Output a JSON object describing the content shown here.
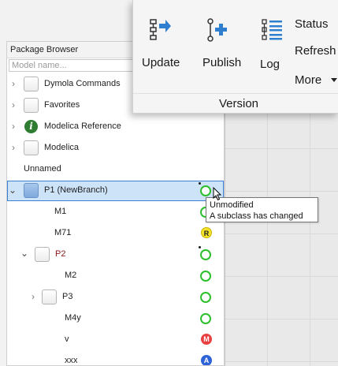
{
  "ribbon": {
    "update_label": "Update",
    "publish_label": "Publish",
    "log_label": "Log",
    "status_label": "Status",
    "refresh_label": "Refresh",
    "more_label": "More",
    "group_label": "Version"
  },
  "browser": {
    "title": "Package Browser",
    "search_placeholder": "Model name...",
    "items": [
      {
        "label": "Dymola Commands"
      },
      {
        "label": "Favorites"
      },
      {
        "label": "Modelica Reference"
      },
      {
        "label": "Modelica"
      },
      {
        "label": "Unnamed"
      },
      {
        "label": "P1 (NewBranch)"
      },
      {
        "label": "M1"
      },
      {
        "label": "M71",
        "badge": "R"
      },
      {
        "label": "P2"
      },
      {
        "label": "M2"
      },
      {
        "label": "P3"
      },
      {
        "label": "M4y"
      },
      {
        "label": "v",
        "badge": "M"
      },
      {
        "label": "xxx",
        "badge": "A"
      }
    ]
  },
  "tooltip": {
    "line1": "Unmodified",
    "line2": "A subclass has changed"
  },
  "colors": {
    "status_ok": "#2bbf2b",
    "badge_r": "#f5e22a",
    "badge_m": "#e84040",
    "badge_a": "#2f63d8",
    "selection": "#cde3f8"
  }
}
